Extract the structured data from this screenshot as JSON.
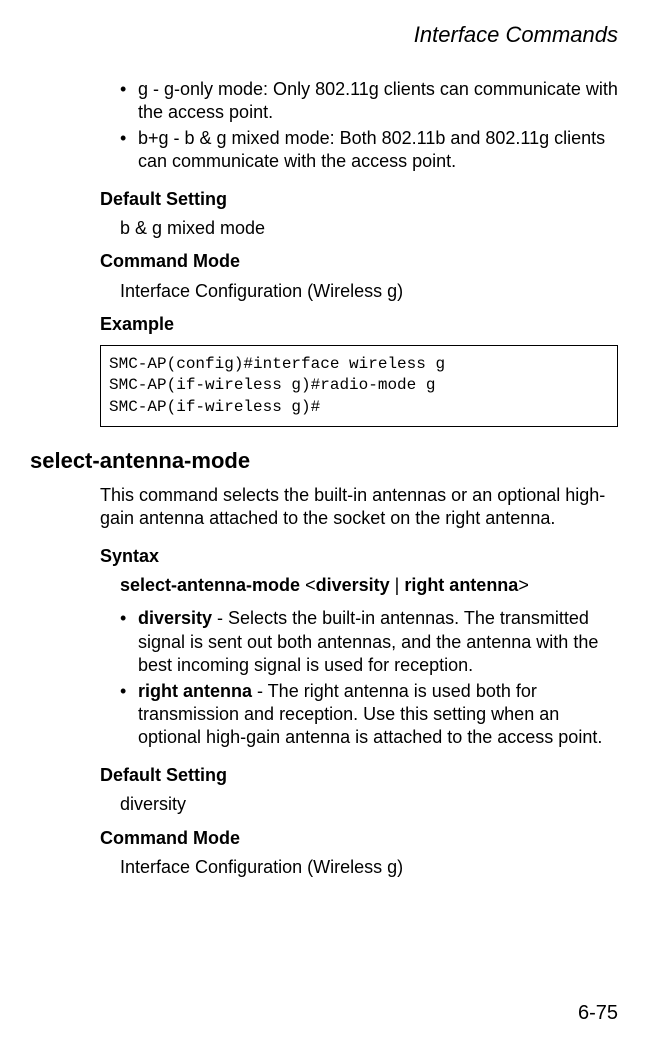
{
  "header": {
    "title": "Interface Commands"
  },
  "top_bullets": [
    "g - g-only mode: Only 802.11g clients can communicate with the access point.",
    "b+g - b & g mixed mode: Both 802.11b and 802.11g clients can communicate with the access point."
  ],
  "section1": {
    "default_setting_label": "Default Setting",
    "default_setting_value": "b & g mixed mode",
    "command_mode_label": "Command Mode",
    "command_mode_value": "Interface Configuration (Wireless g)",
    "example_label": "Example",
    "example_code": "SMC-AP(config)#interface wireless g\nSMC-AP(if-wireless g)#radio-mode g\nSMC-AP(if-wireless g)#"
  },
  "command2": {
    "heading": "select-antenna-mode",
    "description": "This command selects the built-in antennas or an optional high-gain antenna attached to the socket on the right antenna.",
    "syntax_label": "Syntax",
    "syntax_cmd": "select-antenna-mode",
    "syntax_lt": "<",
    "syntax_opt1": "diversity",
    "syntax_pipe": " | ",
    "syntax_opt2": "right antenna",
    "syntax_gt": ">",
    "bullets": [
      {
        "term": "diversity",
        "rest": " - Selects the built-in antennas. The transmitted signal is sent out both antennas, and the antenna with the best incoming signal is used for reception."
      },
      {
        "term": "right antenna",
        "rest": " - The right antenna is used both for transmission and reception. Use this setting when an optional high-gain antenna is attached to the access point."
      }
    ],
    "default_setting_label": "Default Setting",
    "default_setting_value": "diversity",
    "command_mode_label": "Command Mode",
    "command_mode_value": "Interface Configuration (Wireless g)"
  },
  "page_number": "6-75"
}
